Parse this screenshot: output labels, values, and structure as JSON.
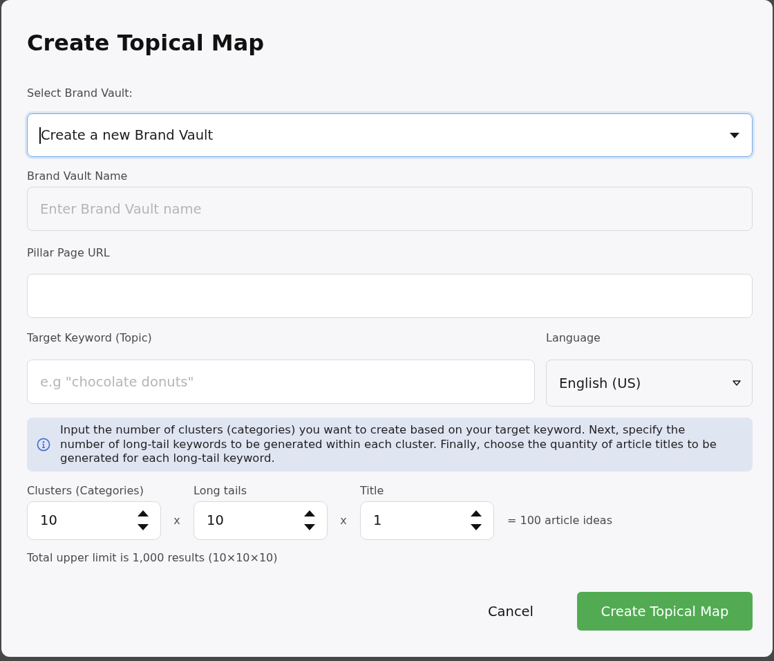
{
  "dialog": {
    "title": "Create Topical Map"
  },
  "brand_vault": {
    "label": "Select Brand Vault:",
    "value": "Create a new Brand Vault",
    "focused": true
  },
  "brand_vault_name": {
    "label": "Brand Vault Name",
    "placeholder": "Enter Brand Vault name"
  },
  "pillar_page_url": {
    "label": "Pillar Page URL"
  },
  "target_keyword": {
    "label": "Target Keyword (Topic)",
    "placeholder": "e.g \"chocolate donuts\""
  },
  "language": {
    "label": "Language",
    "value": "English (US)"
  },
  "info": {
    "text": "Input the number of clusters (categories) you want to create based on your target keyword. Next, specify the number of long-tail keywords to be generated within each cluster. Finally, choose the quantity of article titles to be generated for each long-tail keyword."
  },
  "quantities": [
    {
      "label": "Clusters (Categories)",
      "value": "10"
    },
    {
      "label": "Long tails",
      "value": "10"
    },
    {
      "label": "Title",
      "value": "1"
    }
  ],
  "operators": [
    "x",
    "x"
  ],
  "result": "= 100 article ideas",
  "limit_note": "Total upper limit is 1,000 results (10×10×10)",
  "buttons": [
    {
      "label": "Cancel",
      "kind": "secondary"
    },
    {
      "label": "Create Topical Map",
      "kind": "primary"
    }
  ]
}
